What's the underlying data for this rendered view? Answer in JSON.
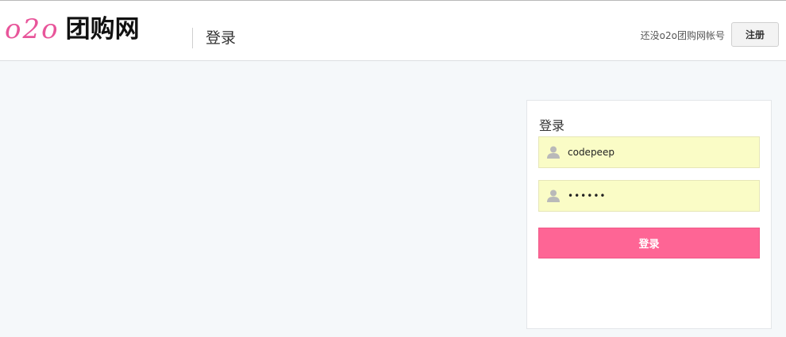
{
  "header": {
    "logo_mark": "o2o",
    "logo_text": "团购网",
    "page_title": "登录",
    "no_account_text": "还没o2o团购网帐号",
    "register_label": "注册"
  },
  "login_panel": {
    "title": "登录",
    "username": {
      "value": "codepeep",
      "icon": "user-icon"
    },
    "password": {
      "value": "••••••",
      "icon": "user-icon"
    },
    "submit_label": "登录"
  },
  "colors": {
    "brand_pink": "#e8559a",
    "button_pink": "#fe6595",
    "field_bg": "#fafcc6",
    "page_bg": "#f5f8fa"
  }
}
